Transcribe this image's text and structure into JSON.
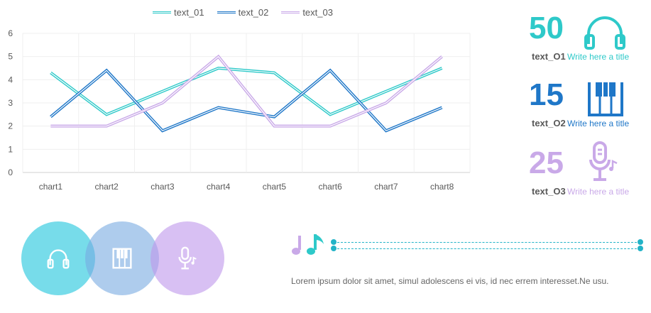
{
  "chart_data": {
    "type": "line",
    "categories": [
      "chart1",
      "chart2",
      "chart3",
      "chart4",
      "chart5",
      "chart6",
      "chart7",
      "chart8"
    ],
    "series": [
      {
        "name": "text_01",
        "color": "#2ec9c9",
        "values": [
          4.3,
          2.5,
          3.5,
          4.5,
          4.3,
          2.5,
          3.5,
          4.5
        ]
      },
      {
        "name": "text_02",
        "color": "#1f77c8",
        "values": [
          2.4,
          4.4,
          1.8,
          2.8,
          2.4,
          4.4,
          1.8,
          2.8
        ]
      },
      {
        "name": "text_03",
        "color": "#c9a9e8",
        "values": [
          2.0,
          2.0,
          3.0,
          5.0,
          2.0,
          2.0,
          3.0,
          5.0
        ]
      }
    ],
    "ylim": [
      0,
      6
    ],
    "yticks": [
      0,
      1,
      2,
      3,
      4,
      5,
      6
    ],
    "grid": true,
    "legend_position": "top",
    "line_style": "double"
  },
  "stats": [
    {
      "value": "50",
      "name": "text_O1",
      "subtitle": "Write here a title",
      "color": "#2ec9c9",
      "icon": "headphones-icon"
    },
    {
      "value": "15",
      "name": "text_O2",
      "subtitle": "Write here a title",
      "color": "#1f77c8",
      "icon": "piano-keys-icon"
    },
    {
      "value": "25",
      "name": "text_O3",
      "subtitle": "Write here a title",
      "color": "#c9a9e8",
      "icon": "microphone-icon"
    }
  ],
  "circles": [
    {
      "icon": "headphones-icon",
      "color": "rgba(46,201,222,0.65)"
    },
    {
      "icon": "piano-keys-icon",
      "color": "rgba(120,170,225,0.6)"
    },
    {
      "icon": "microphone-icon",
      "color": "rgba(190,150,235,0.6)"
    }
  ],
  "lorem": "Lorem ipsum dolor sit amet, simul adolescens ei vis, id nec errem interesset.Ne usu."
}
